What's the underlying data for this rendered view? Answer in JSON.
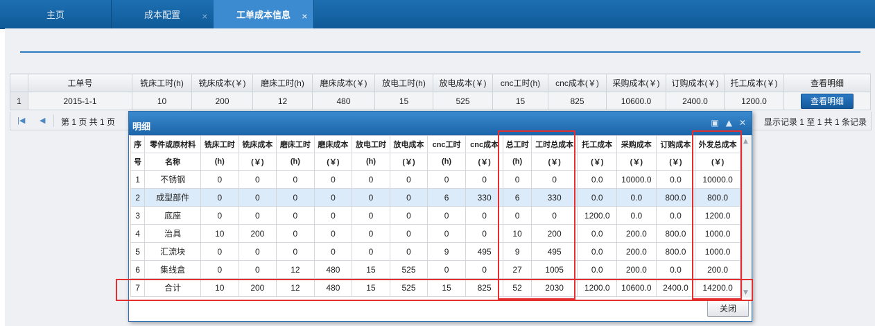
{
  "tabs": [
    {
      "label": "主页"
    },
    {
      "label": "成本配置",
      "close": "×"
    },
    {
      "label": "工单成本信息",
      "close": "×"
    }
  ],
  "grid": {
    "headers": [
      "工单号",
      "铣床工时(h)",
      "铣床成本(￥)",
      "磨床工时(h)",
      "磨床成本(￥)",
      "放电工时(h)",
      "放电成本(￥)",
      "cnc工时(h)",
      "cnc成本(￥)",
      "采购成本(￥)",
      "订购成本(￥)",
      "托工成本(￥)",
      "查看明细"
    ],
    "row": {
      "num": "1",
      "cells": [
        "2015-1-1",
        "10",
        "200",
        "12",
        "480",
        "15",
        "525",
        "15",
        "825",
        "10600.0",
        "2400.0",
        "1200.0"
      ],
      "button": "查看明细"
    }
  },
  "pager": {
    "page_text": "第 1 页 共 1 页",
    "info": "显示记录 1 至 1 共 1 条记录"
  },
  "modal": {
    "title": "明细",
    "close_label": "关闭",
    "header_top": [
      "序",
      "零件或原材料",
      "铣床工时",
      "铣床成本",
      "磨床工时",
      "磨床成本",
      "放电工时",
      "放电成本",
      "cnc工时",
      "cnc成本",
      "总工时",
      "工时总成本",
      "托工成本",
      "采购成本",
      "订购成本",
      "外发总成本"
    ],
    "header_bottom": [
      "号",
      "名称",
      "(h)",
      "(￥)",
      "(h)",
      "(￥)",
      "(h)",
      "(￥)",
      "(h)",
      "(￥)",
      "(h)",
      "(￥)",
      "(￥)",
      "(￥)",
      "(￥)",
      "(￥)"
    ],
    "rows": [
      [
        "1",
        "不锈钢",
        "0",
        "0",
        "0",
        "0",
        "0",
        "0",
        "0",
        "0",
        "0",
        "0",
        "0.0",
        "10000.0",
        "0.0",
        "10000.0"
      ],
      [
        "2",
        "成型部件",
        "0",
        "0",
        "0",
        "0",
        "0",
        "0",
        "6",
        "330",
        "6",
        "330",
        "0.0",
        "0.0",
        "800.0",
        "800.0"
      ],
      [
        "3",
        "底座",
        "0",
        "0",
        "0",
        "0",
        "0",
        "0",
        "0",
        "0",
        "0",
        "0",
        "1200.0",
        "0.0",
        "0.0",
        "1200.0"
      ],
      [
        "4",
        "治具",
        "10",
        "200",
        "0",
        "0",
        "0",
        "0",
        "0",
        "0",
        "10",
        "200",
        "0.0",
        "200.0",
        "800.0",
        "1000.0"
      ],
      [
        "5",
        "汇流块",
        "0",
        "0",
        "0",
        "0",
        "0",
        "0",
        "9",
        "495",
        "9",
        "495",
        "0.0",
        "200.0",
        "800.0",
        "1000.0"
      ],
      [
        "6",
        "集线盒",
        "0",
        "0",
        "12",
        "480",
        "15",
        "525",
        "0",
        "0",
        "27",
        "1005",
        "0.0",
        "200.0",
        "0.0",
        "200.0"
      ],
      [
        "7",
        "合计",
        "10",
        "200",
        "12",
        "480",
        "15",
        "525",
        "15",
        "825",
        "52",
        "2030",
        "1200.0",
        "10600.0",
        "2400.0",
        "14200.0"
      ]
    ],
    "selected_row": 2
  },
  "colors": {
    "tab_bar": "#1d6fb2",
    "accent": "#2d7bc3",
    "highlight": "#e32f2f"
  }
}
